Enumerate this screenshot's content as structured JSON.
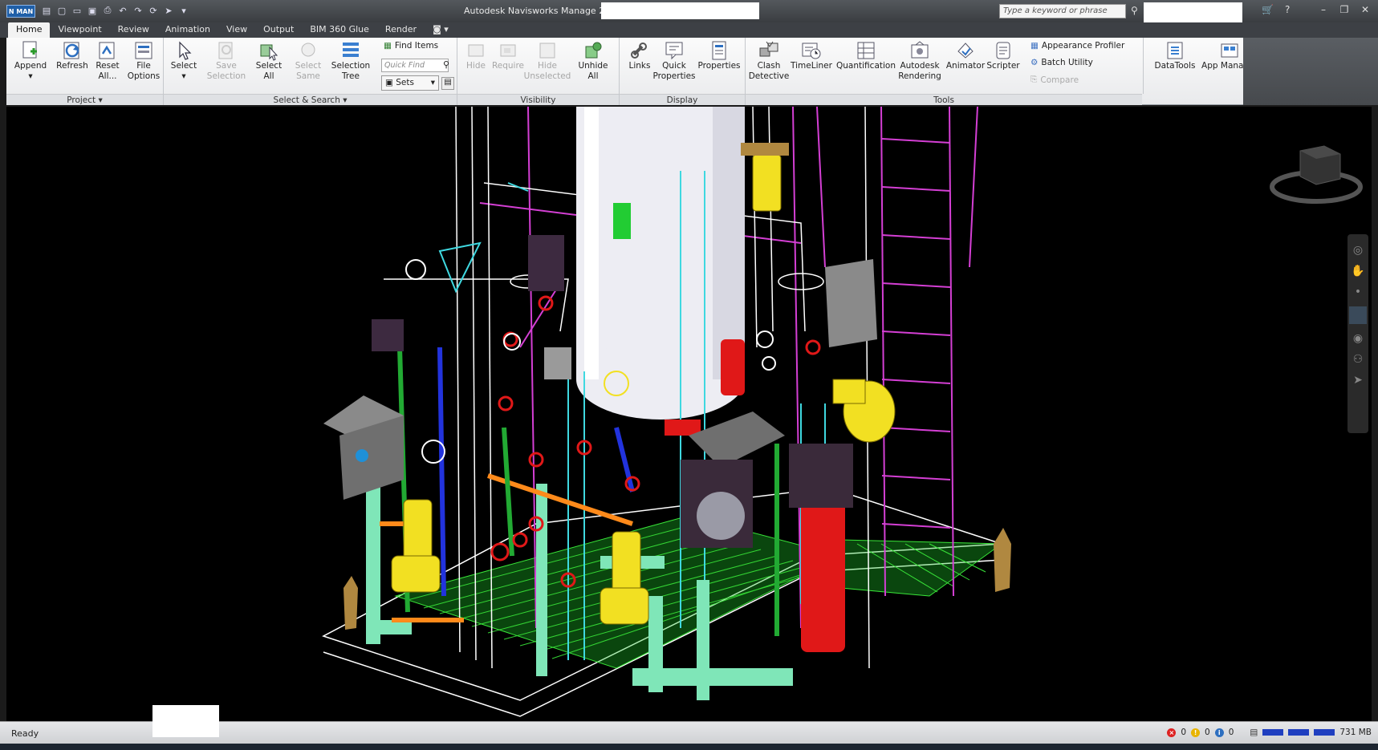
{
  "window": {
    "title": "Autodesk Navisworks Manage 2025",
    "logo": "N MAN",
    "search_placeholder": "Type a keyword or phrase"
  },
  "tabs": [
    "Home",
    "Viewpoint",
    "Review",
    "Animation",
    "View",
    "Output",
    "BIM 360 Glue",
    "Render"
  ],
  "ribbon": {
    "project": {
      "label": "Project ▾",
      "buttons": [
        "Append",
        "Refresh",
        "Reset\nAll...",
        "File\nOptions"
      ]
    },
    "select_search": {
      "label": "Select & Search ▾",
      "buttons": [
        "Select",
        "Save\nSelection",
        "Select\nAll",
        "Select\nSame",
        "Selection\nTree"
      ],
      "find_items": "Find Items",
      "quick_find_placeholder": "Quick Find",
      "sets": "Sets"
    },
    "visibility": {
      "label": "Visibility",
      "buttons": [
        "Hide",
        "Require",
        "Hide\nUnselected",
        "Unhide\nAll"
      ]
    },
    "display": {
      "label": "Display",
      "buttons": [
        "Links",
        "Quick\nProperties",
        "Properties"
      ]
    },
    "tools": {
      "label": "Tools",
      "buttons": [
        "Clash\nDetective",
        "TimeLiner",
        "Quantification",
        "Autodesk\nRendering",
        "Animator",
        "Scripter"
      ],
      "small": [
        "Appearance Profiler",
        "Batch Utility",
        "Compare"
      ]
    },
    "extra": {
      "buttons": [
        "DataTools",
        "App Manager"
      ]
    }
  },
  "status": {
    "text": "Ready",
    "errors": "0",
    "warnings": "0",
    "info": "0",
    "memory": "731 MB"
  },
  "colors": {
    "accent": "#1f5fa8",
    "pipe_green": "#39e639",
    "pipe_magenta": "#d43fd4",
    "pipe_cyan": "#3fd8e0",
    "mint": "#7fe6b8",
    "valve_red": "#e01818",
    "pump_yellow": "#f2e022"
  }
}
